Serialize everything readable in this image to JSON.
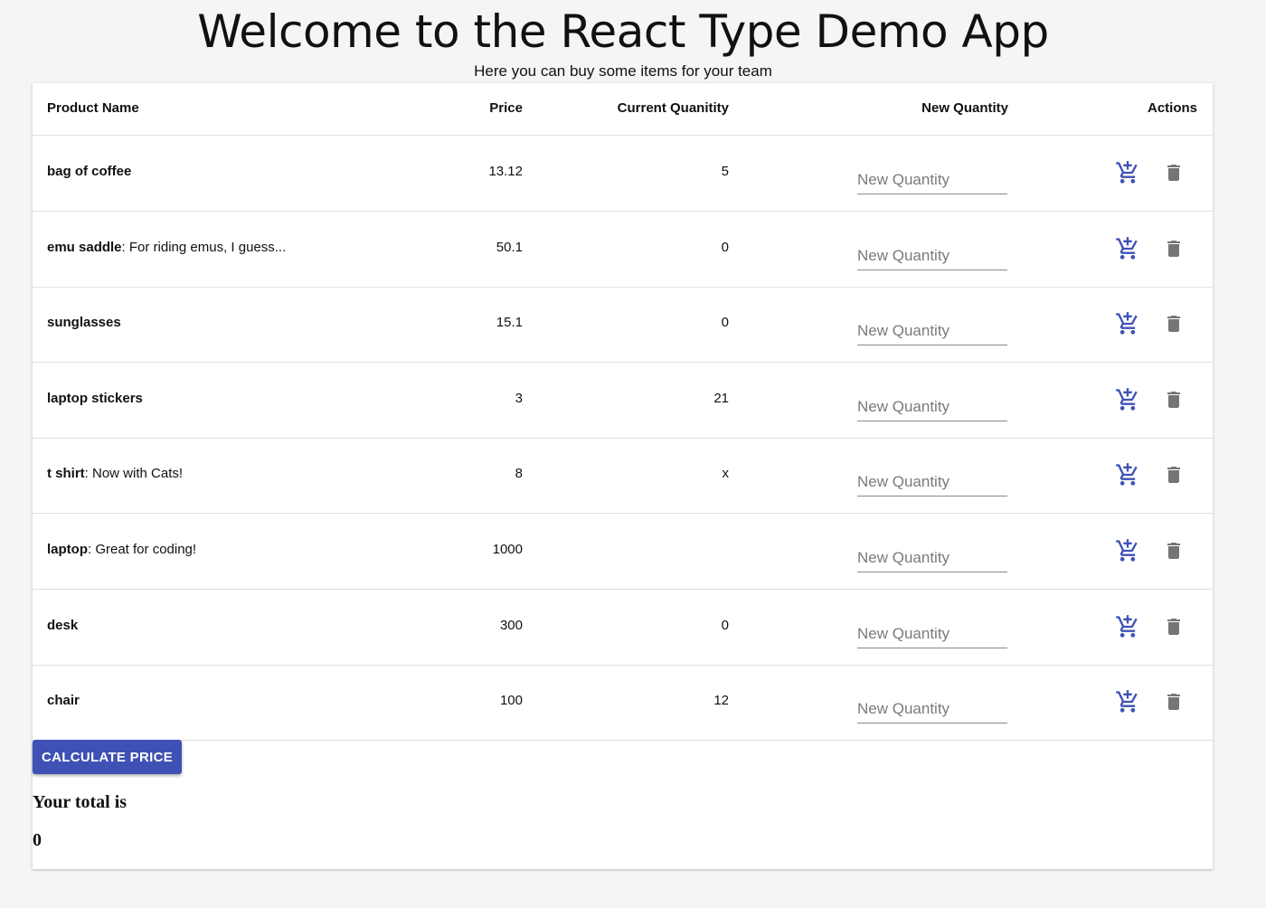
{
  "header": {
    "title": "Welcome to the React Type Demo App",
    "subtitle": "Here you can buy some items for your team"
  },
  "table": {
    "columns": {
      "name": "Product Name",
      "price": "Price",
      "current_quantity": "Current Quanitity",
      "new_quantity": "New Quantity",
      "actions": "Actions"
    },
    "input_placeholder": "New Quantity",
    "rows": [
      {
        "name": "bag of coffee",
        "description": "",
        "price": "13.12",
        "current_quantity": "5"
      },
      {
        "name": "emu saddle",
        "description": ": For riding emus, I guess...",
        "price": "50.1",
        "current_quantity": "0"
      },
      {
        "name": "sunglasses",
        "description": "",
        "price": "15.1",
        "current_quantity": "0"
      },
      {
        "name": "laptop stickers",
        "description": "",
        "price": "3",
        "current_quantity": "21"
      },
      {
        "name": "t shirt",
        "description": ": Now with Cats!",
        "price": "8",
        "current_quantity": "x"
      },
      {
        "name": "laptop",
        "description": ": Great for coding!",
        "price": "1000",
        "current_quantity": ""
      },
      {
        "name": "desk",
        "description": "",
        "price": "300",
        "current_quantity": "0"
      },
      {
        "name": "chair",
        "description": "",
        "price": "100",
        "current_quantity": "12"
      }
    ],
    "row_icons": {
      "add": "add-shopping-cart-icon",
      "delete": "trash-icon"
    }
  },
  "calculate_button_label": "CALCULATE PRICE",
  "total": {
    "label": "Your total is",
    "value": "0"
  },
  "colors": {
    "primary": "#3f51b5",
    "background": "#f5f5f5",
    "delete_icon": "#757575"
  }
}
